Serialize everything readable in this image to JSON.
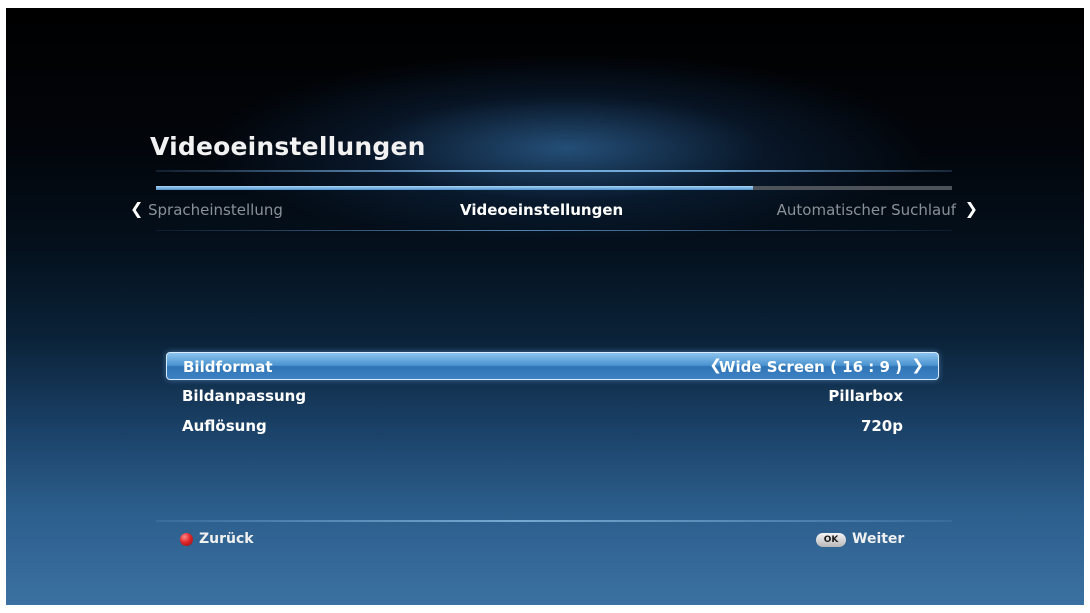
{
  "title": "Videoeinstellungen",
  "progress": {
    "fraction": 0.75
  },
  "nav": {
    "prev_label": "Spracheinstellung",
    "current_label": "Videoeinstellungen",
    "next_label": "Automatischer Suchlauf"
  },
  "settings": [
    {
      "label": "Bildformat",
      "value": "Wide Screen ( 16 : 9 )",
      "selected": true
    },
    {
      "label": "Bildanpassung",
      "value": "Pillarbox",
      "selected": false
    },
    {
      "label": "Auflösung",
      "value": "720p",
      "selected": false
    }
  ],
  "footer": {
    "back_label": "Zurück",
    "ok_icon_text": "OK",
    "next_label": "Weiter"
  },
  "icons": {
    "nav_prev": "chevron-left-icon",
    "nav_next": "chevron-right-icon",
    "value_prev": "chevron-left-icon",
    "value_next": "chevron-right-icon",
    "back": "red-button-icon",
    "next": "ok-button-icon"
  },
  "colors": {
    "selection_top": "#8cc3ee",
    "selection_bottom": "#2f74b6",
    "progress_fill": "#4f95d0",
    "progress_track": "#4d5358",
    "back_button": "#e0262a"
  }
}
